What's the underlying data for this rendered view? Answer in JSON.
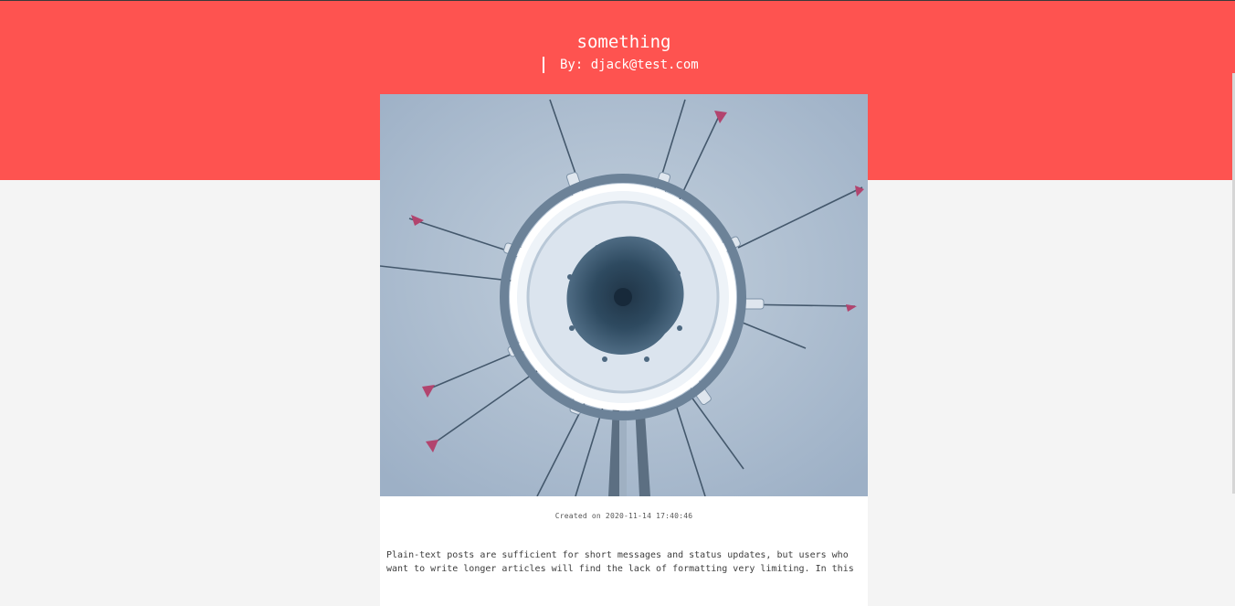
{
  "post": {
    "title": "something",
    "byline": "By: djack@test.com",
    "created": "Created on 2020-11-14 17:40:46",
    "body_line_1": "Plain-text posts are sufficient for short messages and status updates, but users who",
    "body_line_2": "want to write longer articles will find the lack of formatting very limiting. In this"
  },
  "colors": {
    "header_background": "#fe5350",
    "page_background": "#f4f4f4",
    "card_background": "#ffffff"
  },
  "icons": {
    "byline_marker": "vertical-bar-icon"
  }
}
